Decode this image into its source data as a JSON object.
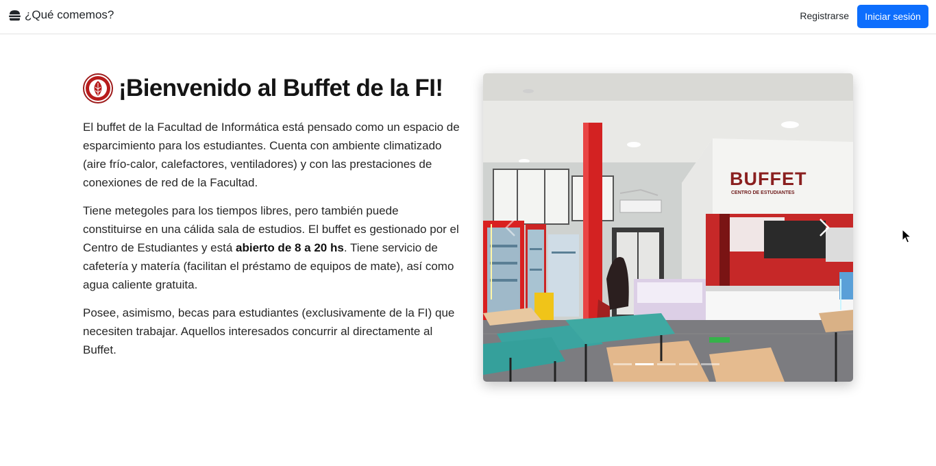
{
  "navbar": {
    "brand_text": "¿Qué comemos?",
    "brand_icon": "hamburger-icon",
    "register_label": "Registrarse",
    "login_label": "Iniciar sesión"
  },
  "intro": {
    "title": "¡Bienvenido al Buffet de la FI!",
    "logo_icon": "university-seal-icon",
    "paragraph_1": "El buffet de la Facultad de Informática está pensado como un espacio de esparcimiento para los estudiantes. Cuenta con ambiente climatizado (aire frío-calor, calefactores, ventiladores) y con las prestaciones de conexiones de red de la Facultad.",
    "paragraph_2_before": "Tiene metegoles para los tiempos libres, pero también puede constituirse en una cálida sala de estudios. El buffet es gestionado por el Centro de Estudiantes y está ",
    "paragraph_2_bold": "abierto de 8 a 20 hs",
    "paragraph_2_after": ". Tiene servicio de cafetería y matería (facilitan el préstamo de equipos de mate), así como agua caliente gratuita.",
    "paragraph_3": "Posee, asimismo, becas para estudiantes (exclusivamente de la FI) que necesiten trabajar. Aquellos interesados concurrir al directamente al Buffet."
  },
  "carousel": {
    "sign_title": "BUFFET",
    "sign_subtitle": "CENTRO DE ESTUDIANTES",
    "slide_count": 5,
    "active_index": 1,
    "prev_icon": "chevron-left-icon",
    "next_icon": "chevron-right-icon"
  },
  "colors": {
    "primary": "#0d6efd",
    "brand_red": "#c62828"
  }
}
